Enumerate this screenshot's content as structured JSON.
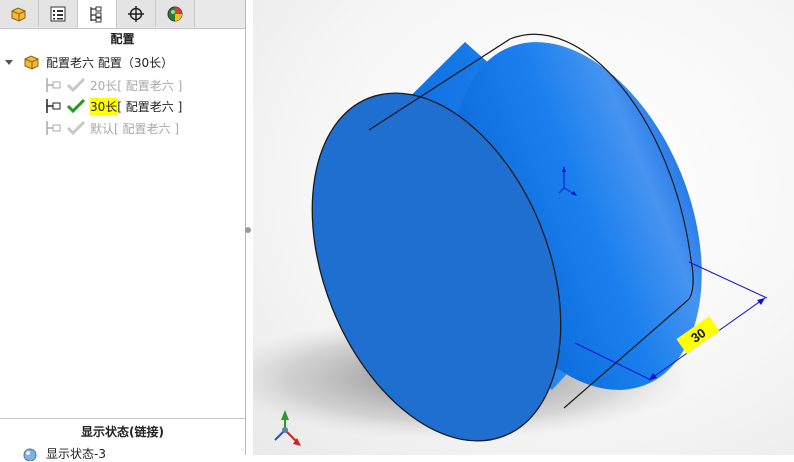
{
  "tabs": [
    {
      "name": "feature-manager-tab-icon"
    },
    {
      "name": "property-manager-tab-icon"
    },
    {
      "name": "configuration-manager-tab-icon"
    },
    {
      "name": "dimxpert-tab-icon"
    },
    {
      "name": "display-manager-tab-icon"
    }
  ],
  "panel": {
    "title": "配置",
    "root": {
      "label": "配置老六 配置（30长）"
    },
    "configs": [
      {
        "name": "20长",
        "suffix": " [ 配置老六 ]",
        "active": false
      },
      {
        "name": "30长",
        "suffix": " [ 配置老六 ]",
        "active": true
      },
      {
        "name": "默认",
        "suffix": " [ 配置老六 ]",
        "active": false
      }
    ]
  },
  "display_states": {
    "title": "显示状态(链接)",
    "item": "显示状态-3"
  },
  "viewport": {
    "dimension_value": "30",
    "model_color": "#1e7fe6",
    "highlight_color": "#ffff00",
    "dimension_color": "#0000cc"
  }
}
